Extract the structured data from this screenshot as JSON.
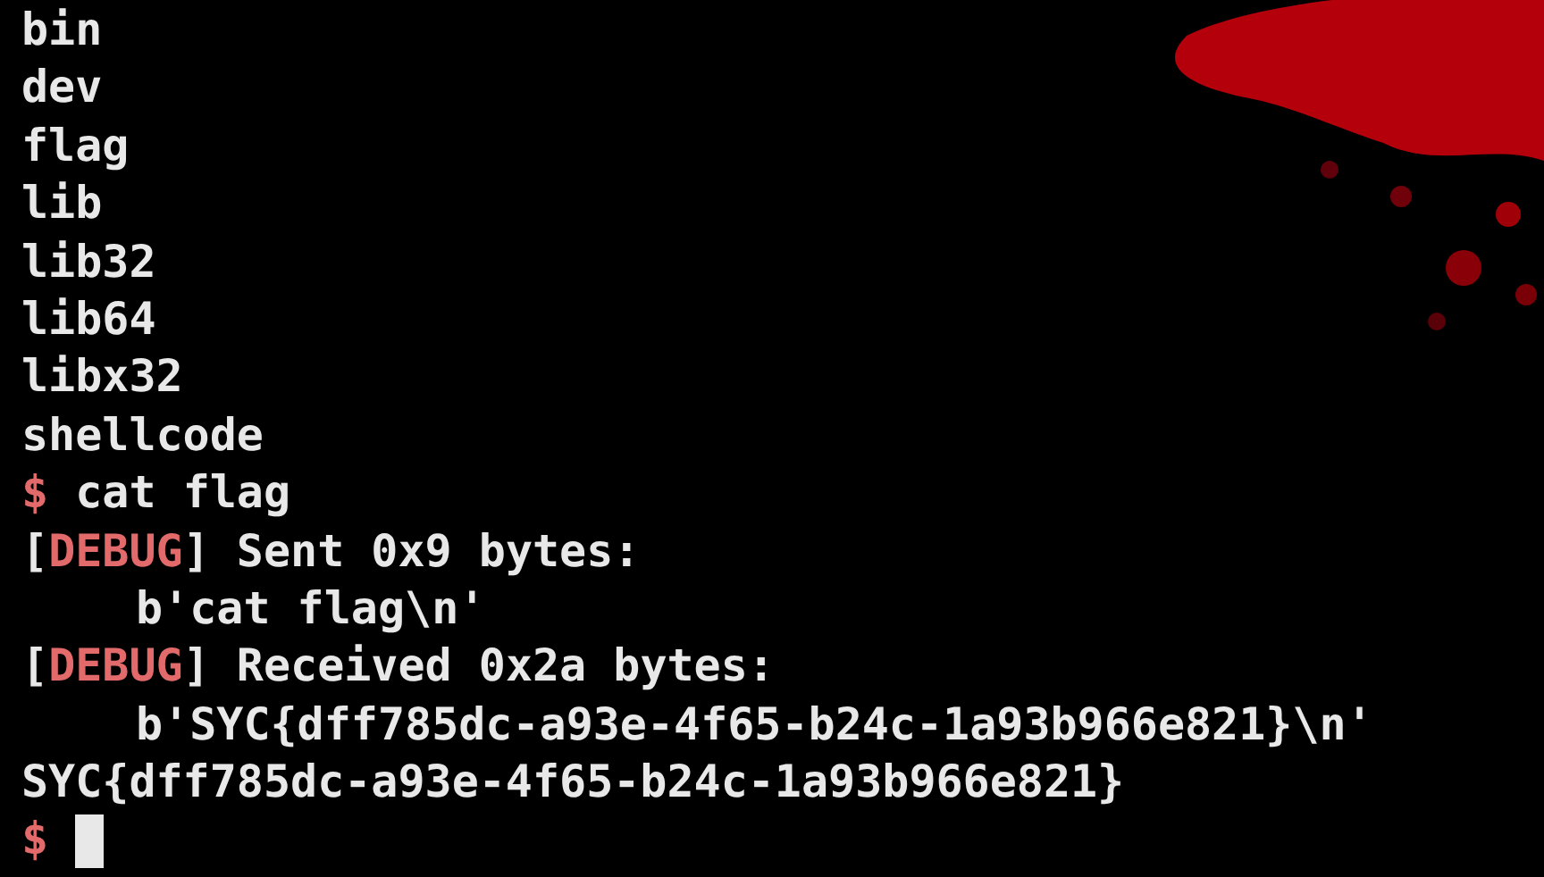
{
  "terminal": {
    "lines": [
      {
        "kind": "output",
        "text": "bin"
      },
      {
        "kind": "output",
        "text": "dev"
      },
      {
        "kind": "output",
        "text": "flag"
      },
      {
        "kind": "output",
        "text": "lib"
      },
      {
        "kind": "output",
        "text": "lib32"
      },
      {
        "kind": "output",
        "text": "lib64"
      },
      {
        "kind": "output",
        "text": "libx32"
      },
      {
        "kind": "output",
        "text": "shellcode"
      },
      {
        "kind": "prompt",
        "prompt": "$",
        "text": "cat flag"
      },
      {
        "kind": "debug",
        "open": "[",
        "tag": "DEBUG",
        "close": "]",
        "text": "Sent 0x9 bytes:"
      },
      {
        "kind": "indented",
        "text": "b'cat flag\\n'"
      },
      {
        "kind": "debug",
        "open": "[",
        "tag": "DEBUG",
        "close": "]",
        "text": "Received 0x2a bytes:"
      },
      {
        "kind": "indented",
        "text": "b'SYC{dff785dc-a93e-4f65-b24c-1a93b966e821}\\n'"
      },
      {
        "kind": "output",
        "text": "SYC{dff785dc-a93e-4f65-b24c-1a93b966e821}"
      },
      {
        "kind": "prompt",
        "prompt": "$",
        "cursor": true
      }
    ]
  }
}
